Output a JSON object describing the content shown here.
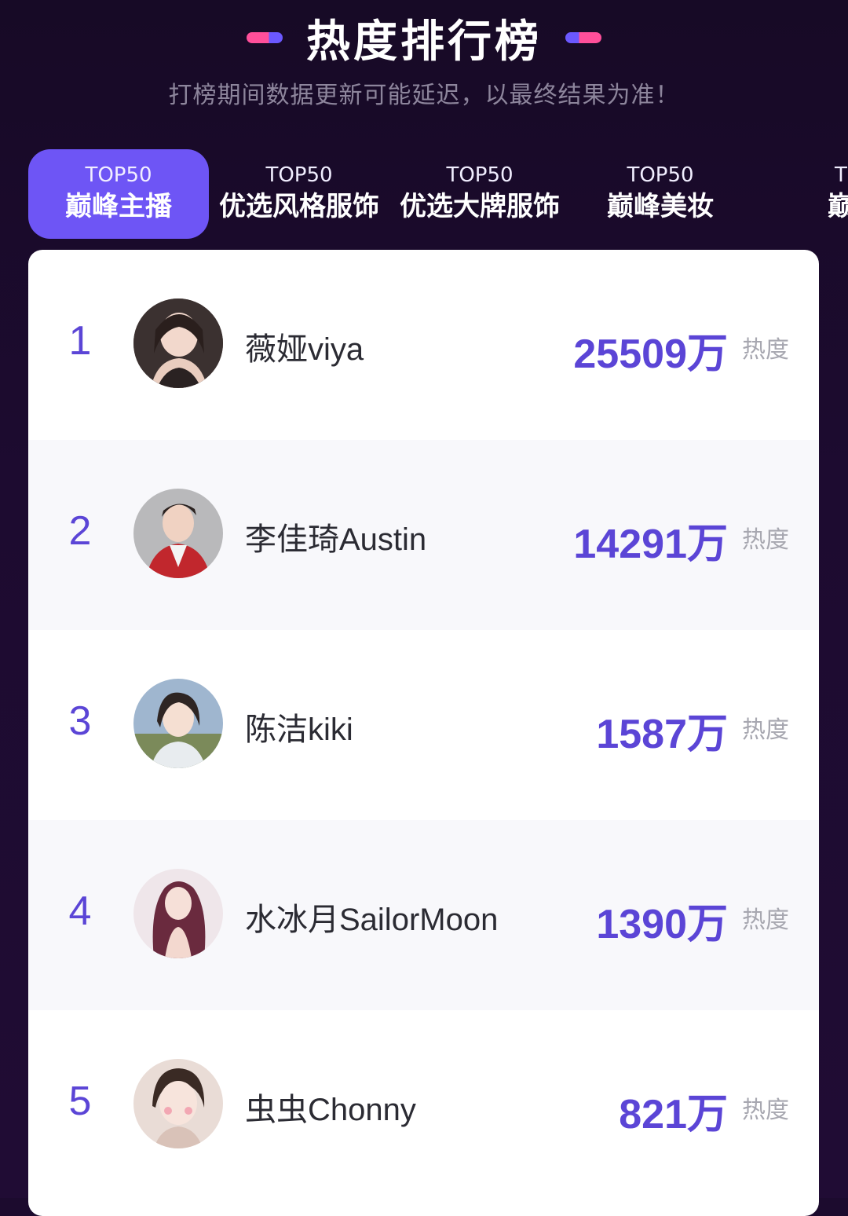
{
  "header": {
    "title": "热度排行榜",
    "subtitle": "打榜期间数据更新可能延迟，以最终结果为准！"
  },
  "tabs": [
    {
      "top": "TOP50",
      "label": "巅峰主播",
      "active": true
    },
    {
      "top": "TOP50",
      "label": "优选风格服饰",
      "active": false
    },
    {
      "top": "TOP50",
      "label": "优选大牌服饰",
      "active": false
    },
    {
      "top": "TOP50",
      "label": "巅峰美妆",
      "active": false
    },
    {
      "top": "T",
      "label": "巅",
      "active": false
    }
  ],
  "ranking": {
    "unit_label": "热度",
    "rows": [
      {
        "rank": "1",
        "name": "薇娅viya",
        "score": "25509万",
        "unit": "热度"
      },
      {
        "rank": "2",
        "name": "李佳琦Austin",
        "score": "14291万",
        "unit": "热度"
      },
      {
        "rank": "3",
        "name": "陈洁kiki",
        "score": "1587万",
        "unit": "热度"
      },
      {
        "rank": "4",
        "name": "水冰月SailorMoon",
        "score": "1390万",
        "unit": "热度"
      },
      {
        "rank": "5",
        "name": "虫虫Chonny",
        "score": "821万",
        "unit": "热度"
      }
    ]
  },
  "colors": {
    "accent": "#6e55f5",
    "rank_and_score": "#5b45d6",
    "background": "#1d0b30",
    "deco_pink": "#ff4f9a",
    "deco_blue": "#6b58ff"
  }
}
